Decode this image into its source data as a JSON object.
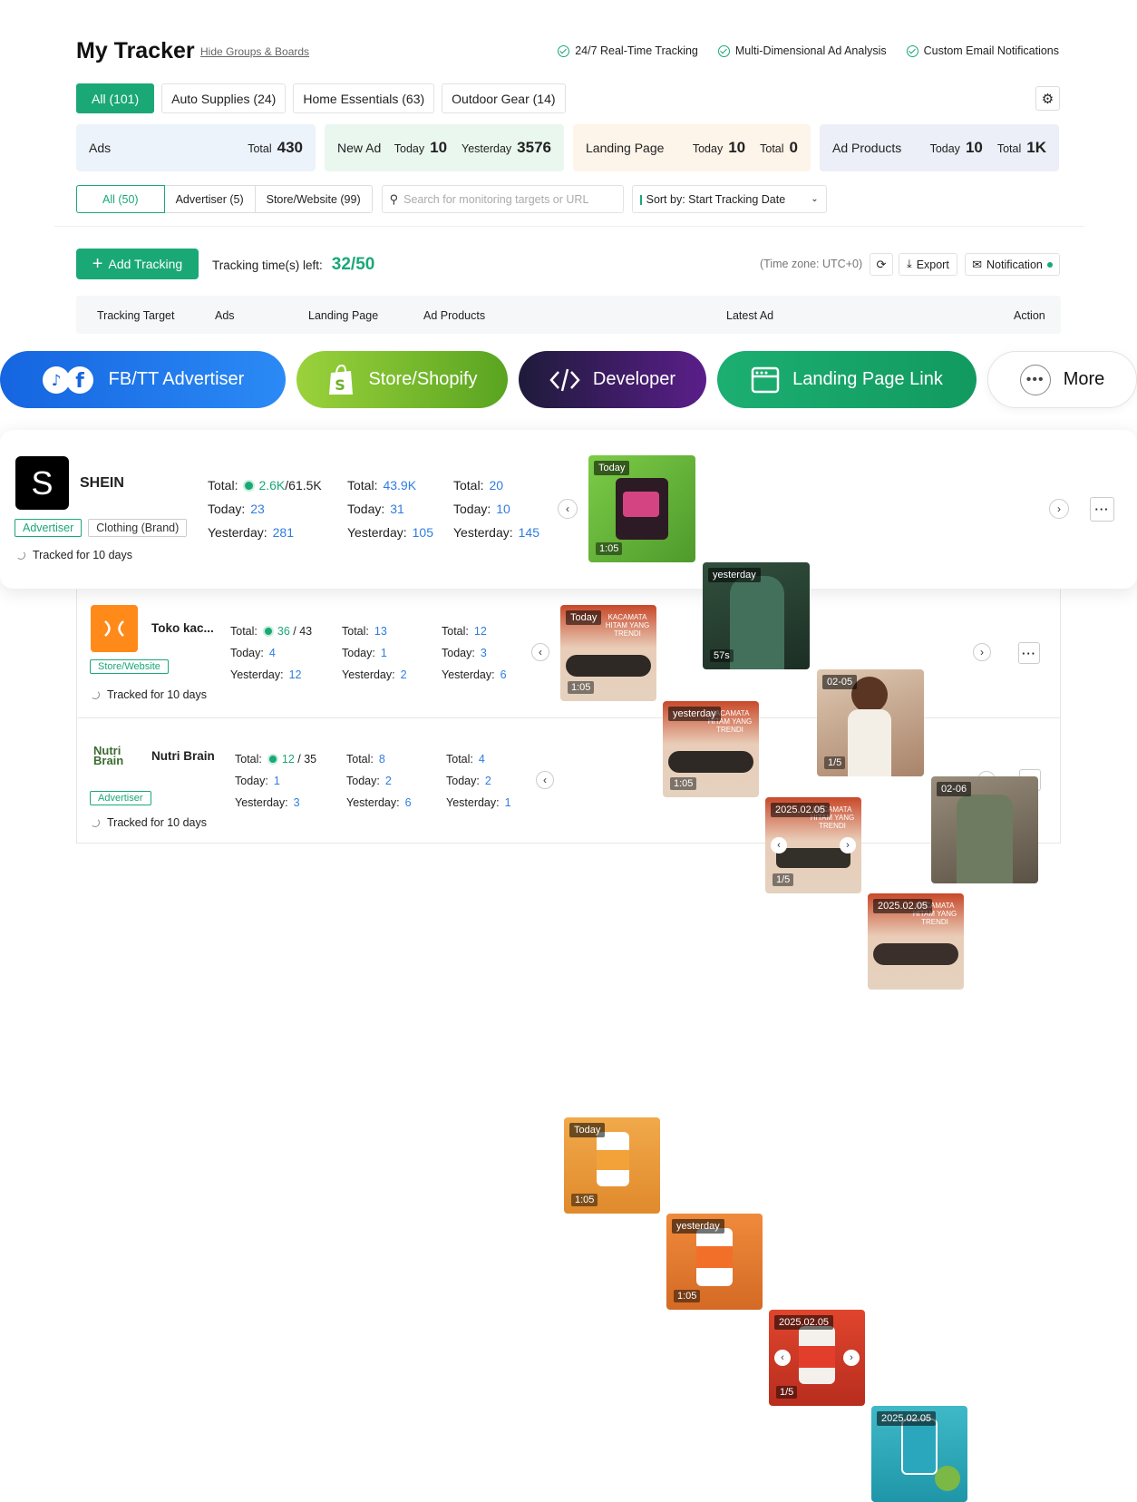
{
  "header": {
    "title": "My Tracker",
    "hide_link": "Hide Groups & Boards",
    "features": [
      "24/7 Real-Time Tracking",
      "Multi-Dimensional Ad Analysis",
      "Custom Email Notifications"
    ]
  },
  "group_tabs": [
    "All (101)",
    "Auto Supplies (24)",
    "Home Essentials (63)",
    "Outdoor Gear (14)"
  ],
  "stats": {
    "ads": {
      "label": "Ads",
      "total_label": "Total",
      "total": "430"
    },
    "new_ad": {
      "label": "New Ad",
      "today_label": "Today",
      "today": "10",
      "yesterday_label": "Yesterday",
      "yesterday": "3576"
    },
    "landing": {
      "label": "Landing Page",
      "today_label": "Today",
      "today": "10",
      "total_label": "Total",
      "total": "0"
    },
    "products": {
      "label": "Ad Products",
      "today_label": "Today",
      "today": "10",
      "total_label": "Total",
      "total": "1K"
    }
  },
  "filters": {
    "segments": [
      "All (50)",
      "Advertiser (5)",
      "Store/Website (99)"
    ],
    "search_placeholder": "Search for monitoring targets or URL",
    "sort_label": "Sort by: Start Tracking Date"
  },
  "toolbar": {
    "add_label": "Add Tracking",
    "times_left_label": "Tracking time(s) left:",
    "times_left_value": "32/50",
    "timezone": "(Time zone: UTC+0)",
    "export_label": "Export",
    "notification_label": "Notification"
  },
  "table_headers": [
    "Tracking Target",
    "Ads",
    "Landing Page",
    "Ad Products",
    "Latest Ad",
    "Action"
  ],
  "categories": [
    "FB/TT Advertiser",
    "Store/Shopify",
    "Developer",
    "Landing Page Link",
    "More"
  ],
  "rows": [
    {
      "name": "SHEIN",
      "logo_text": "S",
      "tags": [
        "Advertiser",
        "Clothing (Brand)"
      ],
      "tracked": "Tracked for 10 days",
      "ads": {
        "total_a": "2.6K",
        "total_b": "/61.5K",
        "today": "23",
        "yesterday": "281"
      },
      "landing": {
        "total": "43.9K",
        "today": "31",
        "yesterday": "105"
      },
      "products": {
        "total": "20",
        "today": "10",
        "yesterday": "145"
      },
      "thumbs": [
        {
          "label": "Today",
          "bottom": "1:05"
        },
        {
          "label": "yesterday",
          "bottom": "57s"
        },
        {
          "label": "02-05",
          "bottom": "1/5"
        },
        {
          "label": "02-06",
          "bottom": ""
        }
      ]
    },
    {
      "name": "Toko kac...",
      "tags": [
        "Store/Website"
      ],
      "tracked": "Tracked for 10 days",
      "ads": {
        "total_a": "36",
        "total_b": " / 43",
        "today": "4",
        "yesterday": "12"
      },
      "landing": {
        "total": "13",
        "today": "1",
        "yesterday": "2"
      },
      "products": {
        "total": "12",
        "today": "3",
        "yesterday": "6"
      },
      "thumbs": [
        {
          "label": "Today",
          "bottom": "1:05",
          "caption": "KACAMATA HITAM YANG TRENDI"
        },
        {
          "label": "yesterday",
          "bottom": "1:05",
          "caption": "KACAMATA HITAM YANG TRENDI"
        },
        {
          "label": "2025.02.05",
          "bottom": "1/5",
          "caption": "KACAMATA HITAM YANG TRENDI"
        },
        {
          "label": "2025.02.05",
          "bottom": "",
          "caption": "KACAMATA HITAM YANG TRENDI"
        }
      ]
    },
    {
      "name": "Nutri Brain",
      "logo_text": "Nutri Brain",
      "tags": [
        "Advertiser"
      ],
      "tracked": "Tracked for 10 days",
      "ads": {
        "total_a": "12",
        "total_b": " / 35",
        "today": "1",
        "yesterday": "3"
      },
      "landing": {
        "total": "8",
        "today": "2",
        "yesterday": "6"
      },
      "products": {
        "total": "4",
        "today": "2",
        "yesterday": "1"
      },
      "thumbs": [
        {
          "label": "Today",
          "bottom": "1:05"
        },
        {
          "label": "yesterday",
          "bottom": "1:05"
        },
        {
          "label": "2025.02.05",
          "bottom": "1/5"
        },
        {
          "label": "2025.02.05",
          "bottom": ""
        }
      ]
    }
  ],
  "labels": {
    "total": "Total:",
    "today": "Today:",
    "yesterday": "Yesterday:"
  }
}
